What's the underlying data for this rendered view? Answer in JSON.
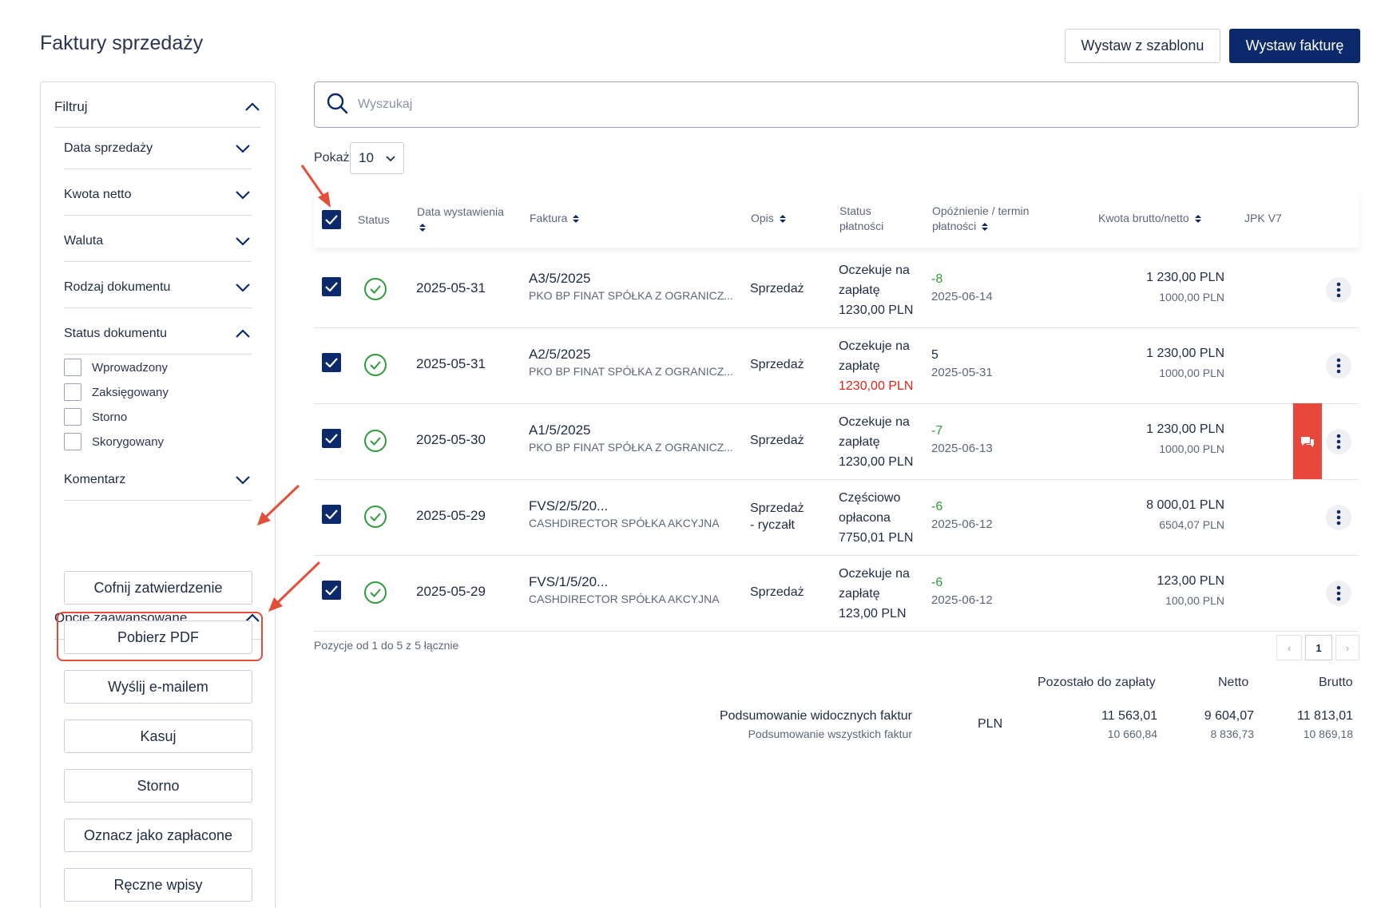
{
  "header": {
    "title": "Faktury sprzedaży",
    "template_button": "Wystaw z szablonu",
    "issue_button": "Wystaw fakturę"
  },
  "filters": {
    "title": "Filtruj",
    "items": [
      "Data sprzedaży",
      "Kwota netto",
      "Waluta",
      "Rodzaj dokumentu"
    ],
    "status": {
      "label": "Status dokumentu",
      "options": [
        "Wprowadzony",
        "Zaksięgowany",
        "Storno",
        "Skorygowany"
      ]
    },
    "comment": "Komentarz"
  },
  "advanced": {
    "title": "Opcje zaawansowane",
    "buttons": [
      "Cofnij zatwierdzenie",
      "Pobierz PDF",
      "Wyślij e-mailem",
      "Kasuj",
      "Storno",
      "Oznacz jako zapłacone",
      "Ręczne wpisy"
    ]
  },
  "search": {
    "placeholder": "Wyszukaj"
  },
  "show": {
    "label": "Pokaż",
    "value": "10"
  },
  "columns": {
    "status": "Status",
    "issue_date": "Data wystawienia",
    "invoice": "Faktura",
    "desc": "Opis",
    "pay_status_1": "Status",
    "pay_status_2": "płatności",
    "delay_1": "Opóźnienie / termin",
    "delay_2": "płatności",
    "amount": "Kwota brutto/netto",
    "jpk": "JPK V7"
  },
  "rows": [
    {
      "date": "2025-05-31",
      "invoice": "A3/5/2025",
      "client": "PKO BP FINAT SPÓŁKA Z OGRANICZ...",
      "desc_1": "Sprzedaż",
      "desc_2": "",
      "pay_1": "Oczekuje na",
      "pay_2": "zapłatę",
      "pay_amount": "1230,00 PLN",
      "pay_amount_color": "#1f2a44",
      "delay": "-8",
      "delay_color": "#2e9b3c",
      "due": "2025-06-14",
      "gross": "1 230,00 PLN",
      "net": "1000,00 PLN"
    },
    {
      "date": "2025-05-31",
      "invoice": "A2/5/2025",
      "client": "PKO BP FINAT SPÓŁKA Z OGRANICZ...",
      "desc_1": "Sprzedaż",
      "desc_2": "",
      "pay_1": "Oczekuje na",
      "pay_2": "zapłatę",
      "pay_amount": "1230,00 PLN",
      "pay_amount_color": "#e1251b",
      "delay": "5",
      "delay_color": "#1f2a44",
      "due": "2025-05-31",
      "gross": "1 230,00 PLN",
      "net": "1000,00 PLN"
    },
    {
      "date": "2025-05-30",
      "invoice": "A1/5/2025",
      "client": "PKO BP FINAT SPÓŁKA Z OGRANICZ...",
      "desc_1": "Sprzedaż",
      "desc_2": "",
      "pay_1": "Oczekuje na",
      "pay_2": "zapłatę",
      "pay_amount": "1230,00 PLN",
      "pay_amount_color": "#1f2a44",
      "delay": "-7",
      "delay_color": "#2e9b3c",
      "due": "2025-06-13",
      "gross": "1 230,00 PLN",
      "net": "1000,00 PLN"
    },
    {
      "date": "2025-05-29",
      "invoice": "FVS/2/5/20...",
      "client": "CASHDIRECTOR SPÓŁKA AKCYJNA",
      "desc_1": "Sprzedaż",
      "desc_2": "- ryczałt",
      "pay_1": "Częściowo",
      "pay_2": "opłacona",
      "pay_amount": "7750,01 PLN",
      "pay_amount_color": "#1f2a44",
      "delay": "-6",
      "delay_color": "#2e9b3c",
      "due": "2025-06-12",
      "gross": "8 000,01 PLN",
      "net": "6504,07 PLN"
    },
    {
      "date": "2025-05-29",
      "invoice": "FVS/1/5/20...",
      "client": "CASHDIRECTOR SPÓŁKA AKCYJNA",
      "desc_1": "Sprzedaż",
      "desc_2": "",
      "pay_1": "Oczekuje na",
      "pay_2": "zapłatę",
      "pay_amount": "123,00 PLN",
      "pay_amount_color": "#1f2a44",
      "delay": "-6",
      "delay_color": "#2e9b3c",
      "due": "2025-06-12",
      "gross": "123,00 PLN",
      "net": "100,00 PLN"
    }
  ],
  "pagination": {
    "info": "Pozycje od 1 do 5 z 5 łącznie",
    "prev": "‹",
    "page": "1",
    "next": "›"
  },
  "summary": {
    "col_remaining": "Pozostało do zapłaty",
    "col_net": "Netto",
    "col_gross": "Brutto",
    "visible_label": "Podsumowanie widocznych faktur",
    "all_label": "Podsumowanie wszystkich faktur",
    "currency": "PLN",
    "visible_remaining": "11 563,01",
    "visible_net": "9 604,07",
    "visible_gross": "11 813,01",
    "all_remaining": "10 660,84",
    "all_net": "8 836,73",
    "all_gross": "10 869,18"
  },
  "colors": {
    "brand": "#0c2a6b",
    "danger": "#e8473c",
    "success": "#2e9b3c",
    "annotation": "#e2503a"
  }
}
